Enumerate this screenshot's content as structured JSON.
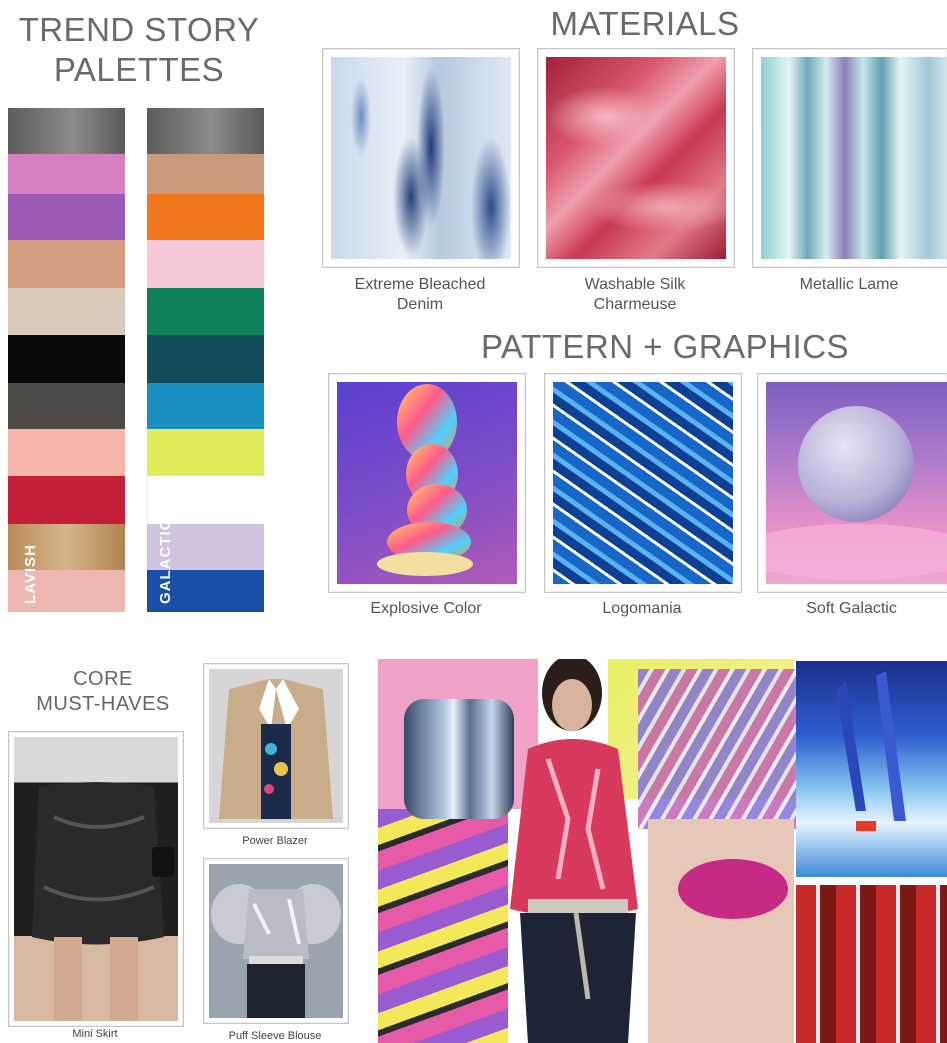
{
  "headings": {
    "trend_line1": "TREND STORY",
    "trend_line2": "PALETTES",
    "materials": "MATERIALS",
    "pattern": "PATTERN + GRAPHICS",
    "core_line1": "CORE",
    "core_line2": "MUST-HAVES"
  },
  "palettes": {
    "lavish": {
      "label": "LAVISH",
      "colors": [
        "#6e6e6e",
        "#d77fc0",
        "#9a5ab5",
        "#d49c7e",
        "#d8c9bb",
        "#0b0b0b",
        "#4d4945",
        "#f6b6a9",
        "#c41e39",
        "#c6a06e",
        "#eeb7af"
      ]
    },
    "galactica": {
      "label": "GALACTICA",
      "colors": [
        "#6e6e6e",
        "#c99a7c",
        "#f2781e",
        "#f7c8d6",
        "#0e8156",
        "#124b5c",
        "#1b8fc1",
        "#e1ec5b",
        "#ffffff",
        "#cfc3e0",
        "#1a4fa8"
      ]
    }
  },
  "materials": [
    {
      "caption_line1": "Extreme Bleached",
      "caption_line2": "Denim",
      "icon": "denim-texture"
    },
    {
      "caption_line1": "Washable Silk",
      "caption_line2": "Charmeuse",
      "icon": "silk-texture"
    },
    {
      "caption_line1": "Metallic Lame",
      "caption_line2": "",
      "icon": "metallic-texture"
    }
  ],
  "patterns": [
    {
      "caption": "Explosive Color",
      "icon": "stacked-ovals-art"
    },
    {
      "caption": "Logomania",
      "icon": "logo-print"
    },
    {
      "caption": "Soft Galactic",
      "icon": "moon-sphere"
    }
  ],
  "must_haves": [
    {
      "caption": "Mini Skirt"
    },
    {
      "caption": "Power Blazer"
    },
    {
      "caption": "Puff Sleeve Blouse"
    }
  ]
}
